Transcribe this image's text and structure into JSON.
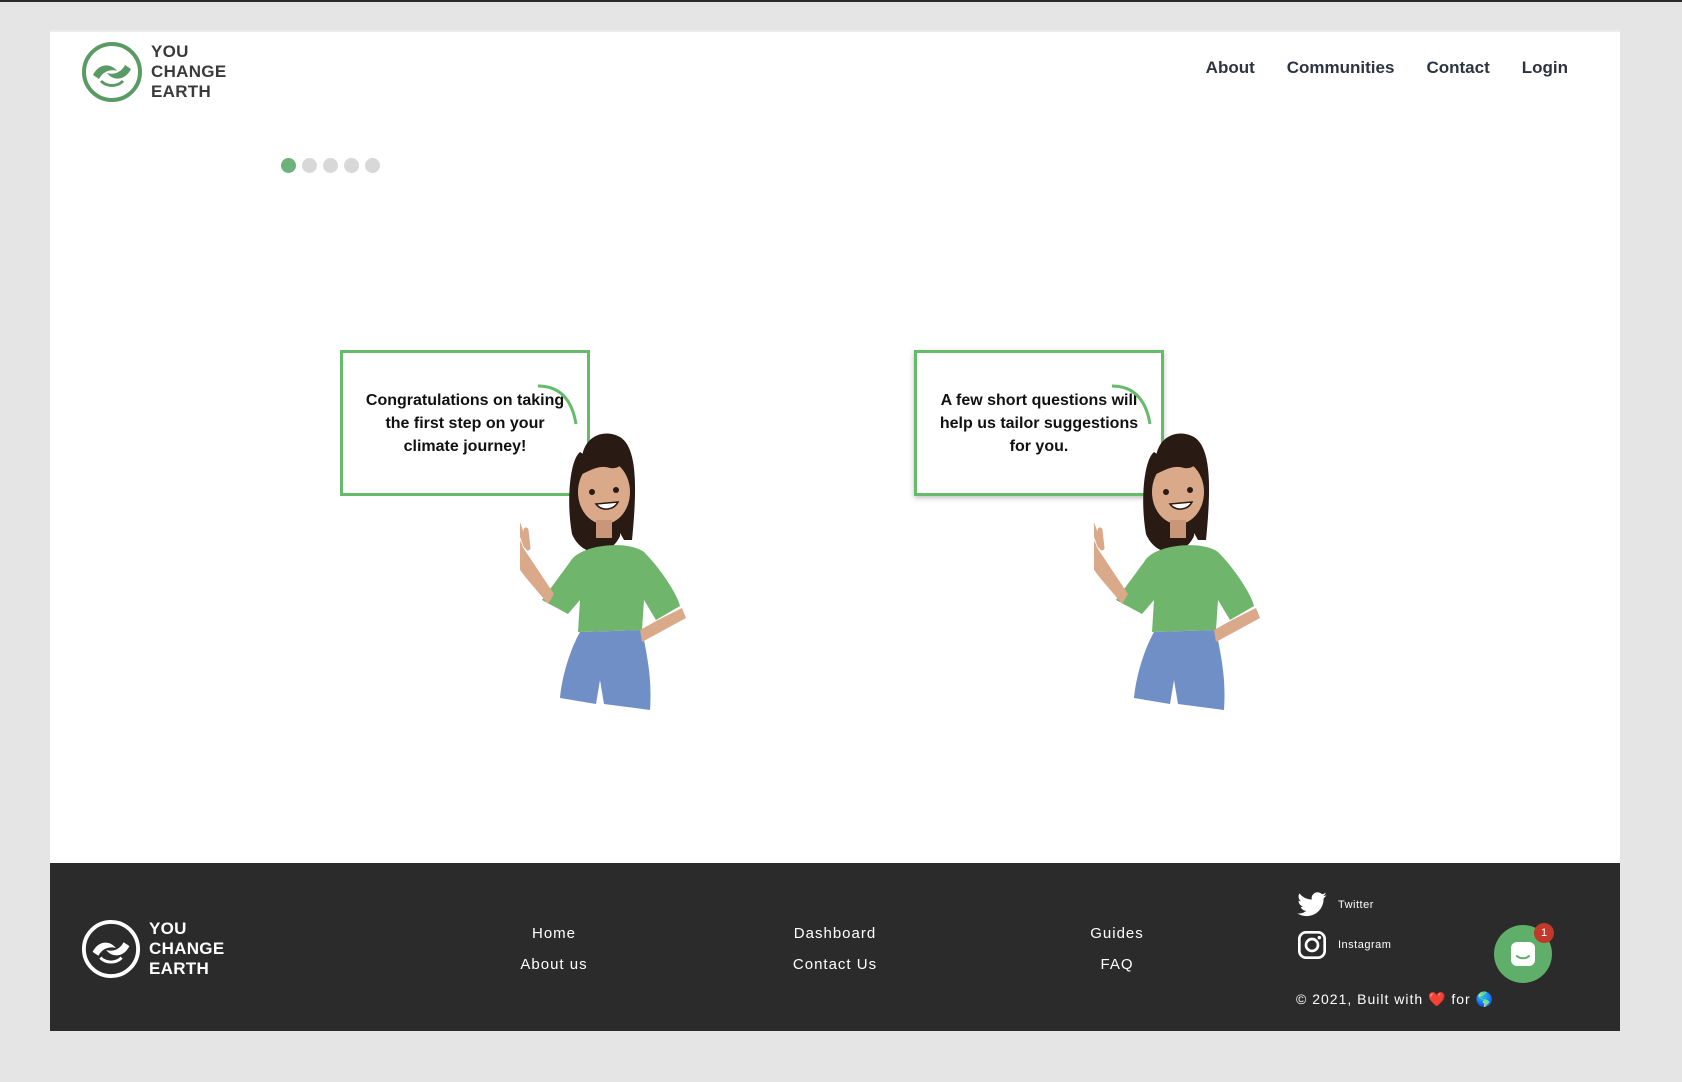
{
  "brand": {
    "line1": "YOU",
    "line2": "CHANGE",
    "line3": "EARTH"
  },
  "nav": {
    "items": [
      "About",
      "Communities",
      "Contact",
      "Login"
    ]
  },
  "progress": {
    "total_steps": 5,
    "current_step": 1
  },
  "slides": [
    {
      "text": "Congratulations on taking the first step on your climate journey!"
    },
    {
      "text": "A few short questions will help us tailor suggestions for you."
    }
  ],
  "footer": {
    "col1": [
      "Home",
      "About us"
    ],
    "col2": [
      "Dashboard",
      "Contact Us"
    ],
    "col3": [
      "Guides",
      "FAQ"
    ],
    "social": {
      "twitter": "Twitter",
      "instagram": "Instagram"
    },
    "copyright_prefix": "© 2021, Built with",
    "heart": "❤️",
    "for_word": "for",
    "globe": "🌎"
  },
  "chat": {
    "badge": "1"
  },
  "colors": {
    "accent": "#66bb6a",
    "footer_bg": "#2b2b2b",
    "shirt": "#6fb56b",
    "pants": "#6f8fc6",
    "skin": "#d9a98a",
    "hair": "#2a1a14"
  },
  "icons": [
    "logo-icon",
    "twitter-icon",
    "instagram-icon",
    "chat-icon"
  ]
}
